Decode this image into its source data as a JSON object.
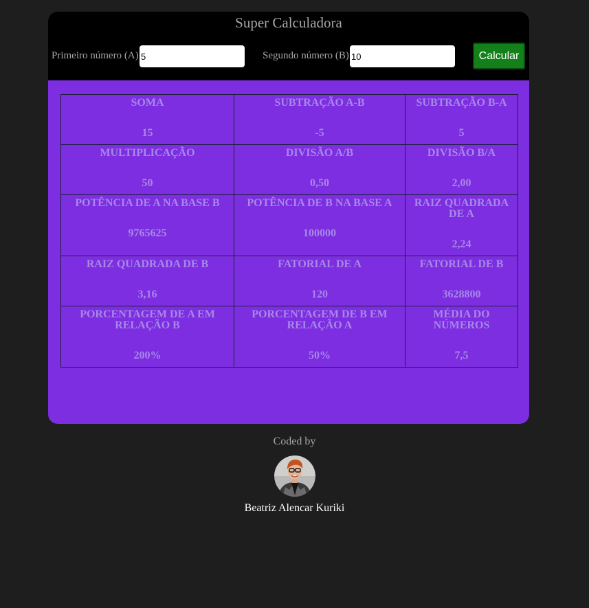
{
  "colors": {
    "page_background": "#1e1e1e",
    "card_background": "#7d2ee0",
    "header_background": "#000000",
    "button_background": "#14801a",
    "result_text": "#a788e8"
  },
  "header": {
    "title": "Super Calculadora",
    "input_a": {
      "label": "Primeiro número (A)",
      "value": "5"
    },
    "input_b": {
      "label": "Segundo número (B)",
      "value": "10"
    },
    "calculate_label": "Calcular"
  },
  "results": [
    [
      {
        "label": "SOMA",
        "value": "15"
      },
      {
        "label": "SUBTRAÇÃO A-B",
        "value": "-5"
      },
      {
        "label": "SUBTRAÇÃO B-A",
        "value": "5"
      }
    ],
    [
      {
        "label": "MULTIPLICAÇÃO",
        "value": "50"
      },
      {
        "label": "DIVISÃO A/B",
        "value": "0,50"
      },
      {
        "label": "DIVISÃO B/A",
        "value": "2,00"
      }
    ],
    [
      {
        "label": "POTÊNCIA DE A NA BASE B",
        "value": "9765625"
      },
      {
        "label": "POTÊNCIA DE B NA BASE A",
        "value": "100000"
      },
      {
        "label": "RAIZ QUADRADA DE A",
        "value": "2,24"
      }
    ],
    [
      {
        "label": "RAIZ QUADRADA DE B",
        "value": "3,16"
      },
      {
        "label": "FATORIAL DE A",
        "value": "120"
      },
      {
        "label": "FATORIAL DE B",
        "value": "3628800"
      }
    ],
    [
      {
        "label": "PORCENTAGEM DE A EM RELAÇÃO B",
        "value": "200%"
      },
      {
        "label": "PORCENTAGEM DE B EM RELAÇÃO A",
        "value": "50%"
      },
      {
        "label": "MÉDIA DO NÚMEROS",
        "value": "7,5"
      }
    ]
  ],
  "footer": {
    "coded_by": "Coded by",
    "avatar_icon": "author-photo",
    "author_name": "Beatriz Alencar Kuriki"
  }
}
